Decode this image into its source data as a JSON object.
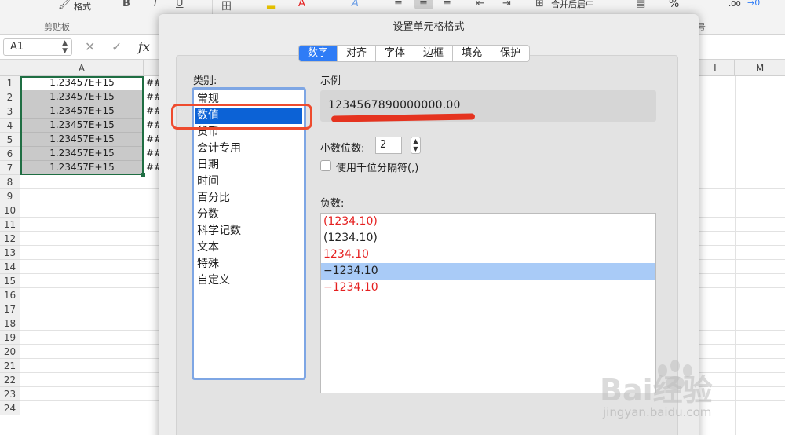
{
  "ribbon": {
    "format_painter_label": "格式",
    "clipboard_group": "剪贴板",
    "group_label_right": "号",
    "merge_center_label": "合并后居中",
    "percent_symbol": "%",
    "decimal_label": ".00",
    "arrow_label": "→0"
  },
  "formula_bar": {
    "cell_ref": "A1",
    "cancel_icon": "✕",
    "confirm_icon": "✓",
    "fx_label": "fx"
  },
  "sheet": {
    "columns": [
      "A",
      "L",
      "M"
    ],
    "rows": [
      "1",
      "2",
      "3",
      "4",
      "5",
      "6",
      "7",
      "8",
      "9",
      "10",
      "11",
      "12",
      "13",
      "14",
      "15",
      "16",
      "17",
      "18",
      "19",
      "20",
      "21",
      "22",
      "23",
      "24"
    ],
    "col_a_values": [
      "1.23457E+15",
      "1.23457E+15",
      "1.23457E+15",
      "1.23457E+15",
      "1.23457E+15",
      "1.23457E+15",
      "1.23457E+15"
    ],
    "col_b_overflow": "##"
  },
  "dialog": {
    "title": "设置单元格格式",
    "tabs": [
      "数字",
      "对齐",
      "字体",
      "边框",
      "填充",
      "保护"
    ],
    "active_tab": "数字",
    "category_label": "类别:",
    "categories": [
      "常规",
      "数值",
      "货币",
      "会计专用",
      "日期",
      "时间",
      "百分比",
      "分数",
      "科学记数",
      "文本",
      "特殊",
      "自定义"
    ],
    "selected_category": "数值",
    "sample_label": "示例",
    "sample_value": "1234567890000000.00",
    "decimal_places_label": "小数位数:",
    "decimal_places_value": "2",
    "thousands_separator_label": "使用千位分隔符(,)",
    "negative_label": "负数:",
    "negative_options": [
      {
        "text": "(1234.10)",
        "color": "#e52020"
      },
      {
        "text": "(1234.10)",
        "color": "#222222"
      },
      {
        "text": "1234.10",
        "color": "#e52020"
      },
      {
        "text": "−1234.10",
        "color": "#222222"
      },
      {
        "text": "−1234.10",
        "color": "#e52020"
      }
    ],
    "selected_negative_index": 3
  },
  "watermark": {
    "brand": "Bai经验",
    "url": "jingyan.baidu.com"
  },
  "colors": {
    "tab_active": "#2f7cf6",
    "list_selection": "#0c62d6",
    "negative_selection": "#a9cbf7",
    "annotation_red": "#ee4b2e",
    "excel_green": "#1f6e43"
  }
}
